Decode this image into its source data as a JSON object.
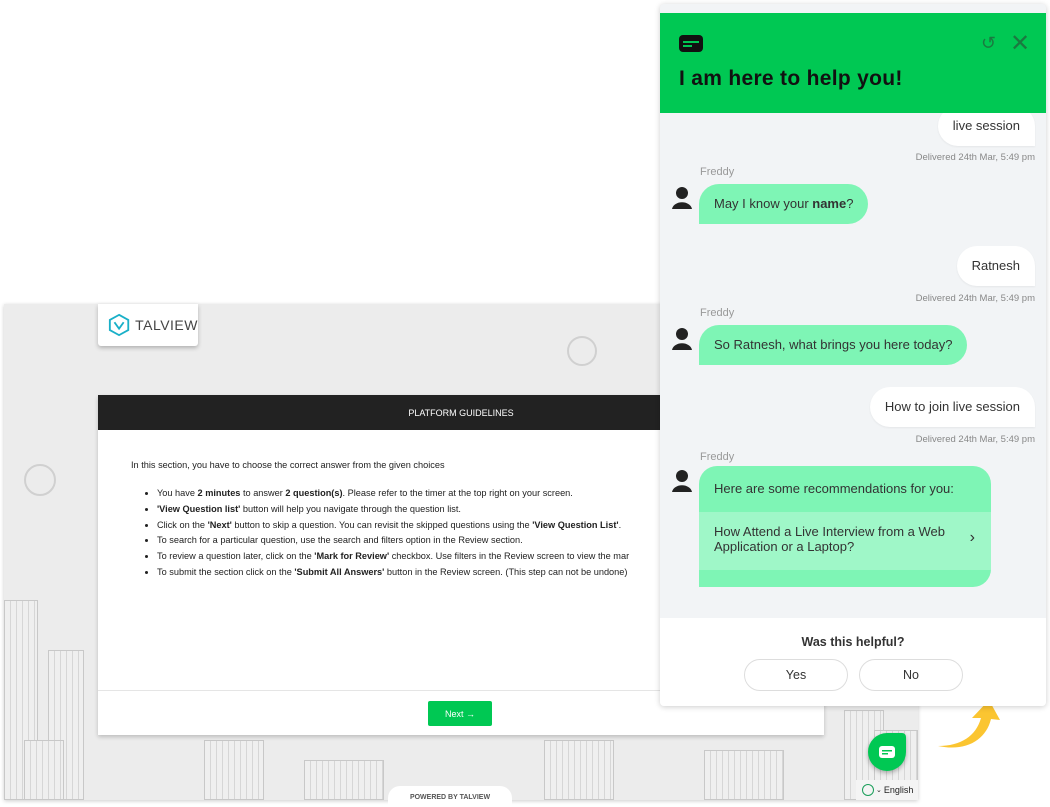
{
  "app": {
    "logo_text": "TALVIEW",
    "modal_title": "PLATFORM GUIDELINES",
    "intro": "In this section, you have to choose the correct answer from the given choices",
    "bullets": [
      [
        "You have ",
        "2 minutes",
        " to answer ",
        "2 question(s)",
        ". Please refer to the timer at the top right on your screen."
      ],
      [
        "",
        "'View Question list'",
        " button will help you navigate through the question list.",
        "",
        ""
      ],
      [
        "Click on the ",
        "'Next'",
        " button to skip a question. You can revisit the skipped questions using the ",
        "'View Question List'",
        "."
      ],
      [
        "To search for a particular question, use the search and filters option in the Review section.",
        "",
        "",
        "",
        ""
      ],
      [
        "To review a question later, click on the ",
        "'Mark for Review'",
        " checkbox. Use filters in the Review screen to view the mar",
        "",
        ""
      ],
      [
        "To submit the section click on the ",
        "'Submit All Answers'",
        " button in the Review screen. (This step can not be undone)",
        "",
        ""
      ]
    ],
    "next_label": "Next",
    "next_icon": "arrow-right",
    "powered": "POWERED BY TALVIEW",
    "language": "English"
  },
  "chat": {
    "title": "I am here to help you!",
    "accent": "#00c853",
    "bot_bubble": "#7ef5b5",
    "messages": [
      {
        "from": "user",
        "text": "live session",
        "status": "Delivered  24th Mar, 5:49 pm"
      },
      {
        "from": "bot",
        "name": "Freddy",
        "text_pre": "May I know your ",
        "text_bold": "name",
        "text_post": "?"
      },
      {
        "from": "user",
        "text": "Ratnesh",
        "status": "Delivered  24th Mar, 5:49 pm"
      },
      {
        "from": "bot",
        "name": "Freddy",
        "text": "So Ratnesh, what brings you here today?"
      },
      {
        "from": "user",
        "text": "How to join live session",
        "status": "Delivered  24th Mar, 5:49 pm"
      },
      {
        "from": "bot",
        "name": "Freddy",
        "text": "Here are some recommendations for you:",
        "option": "How Attend a Live Interview from a Web Application or a Laptop?"
      }
    ],
    "feedback": {
      "question": "Was this helpful?",
      "yes": "Yes",
      "no": "No"
    }
  }
}
